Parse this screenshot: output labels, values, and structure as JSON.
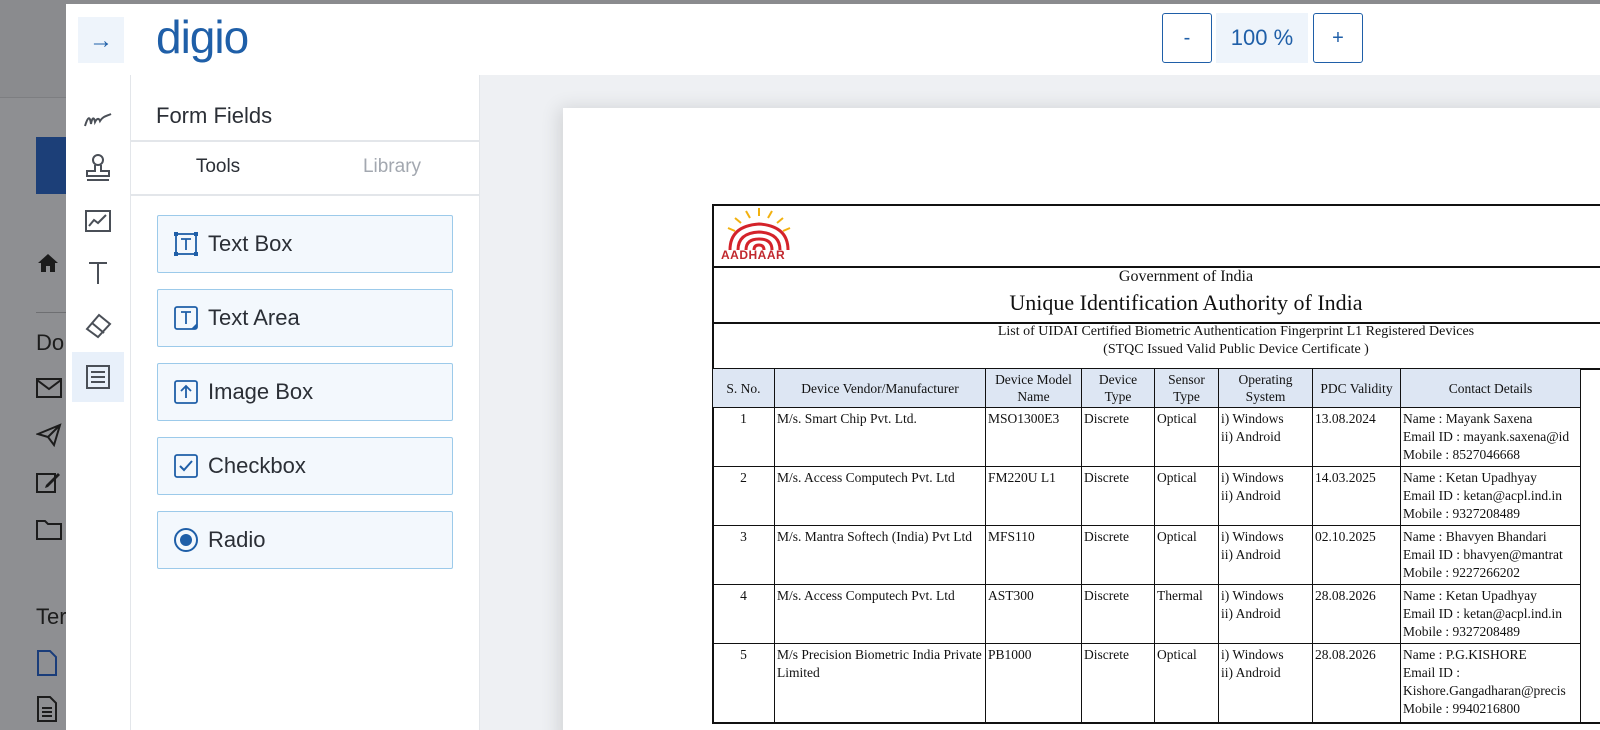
{
  "background": {
    "partial_labels": [
      "Do",
      "Ter"
    ]
  },
  "header": {
    "back_icon": "arrow-right-icon",
    "logo_text": "digio",
    "zoom": {
      "minus_label": "-",
      "level": "100 %",
      "plus_label": "+"
    }
  },
  "toolrail": {
    "items": [
      {
        "icon": "signature-icon"
      },
      {
        "icon": "stamp-icon"
      },
      {
        "icon": "chart-image-icon"
      },
      {
        "icon": "text-icon"
      },
      {
        "icon": "eraser-icon"
      },
      {
        "icon": "form-fields-icon",
        "active": true
      }
    ]
  },
  "panel": {
    "title": "Form Fields",
    "tabs": {
      "tools": "Tools",
      "library": "Library"
    },
    "fields": [
      {
        "label": "Text Box",
        "icon": "text-box-icon"
      },
      {
        "label": "Text Area",
        "icon": "text-area-icon"
      },
      {
        "label": "Image Box",
        "icon": "image-upload-icon"
      },
      {
        "label": "Checkbox",
        "icon": "checkbox-icon"
      },
      {
        "label": "Radio",
        "icon": "radio-icon"
      }
    ]
  },
  "document": {
    "logo_text": "AADHAAR",
    "government": "Government of India",
    "authority": "Unique Identification Authority of  India",
    "list_title": "List of UIDAI Certified Biometric Authentication Fingerprint L1 Registered Devices",
    "list_subtitle": "(STQC Issued  Valid Public Device Certificate )",
    "table": {
      "headers": [
        "S. No.",
        "Device Vendor/Manufacturer",
        "Device Model Name",
        "Device Type",
        "Sensor Type",
        "Operating System",
        "PDC Validity",
        "Contact Details"
      ],
      "rows": [
        {
          "sno": "1",
          "vendor": "M/s. Smart Chip Pvt. Ltd.",
          "model": "MSO1300E3",
          "type": "Discrete",
          "sensor": "Optical",
          "os1": "i) Windows",
          "os2": "ii) Android",
          "pdc": "13.08.2024",
          "c1": "Name : Mayank Saxena",
          "c2": "Email ID : mayank.saxena@id",
          "c3": "Mobile : 8527046668"
        },
        {
          "sno": "2",
          "vendor": "M/s. Access Computech Pvt. Ltd",
          "model": "FM220U L1",
          "type": "Discrete",
          "sensor": "Optical",
          "os1": "i) Windows",
          "os2": "ii) Android",
          "pdc": "14.03.2025",
          "c1": "Name : Ketan Upadhyay",
          "c2": "Email ID : ketan@acpl.ind.in",
          "c3": "Mobile : 9327208489"
        },
        {
          "sno": "3",
          "vendor": "M/s. Mantra Softech (India) Pvt Ltd",
          "model": "MFS110",
          "type": "Discrete",
          "sensor": "Optical",
          "os1": "i) Windows",
          "os2": "ii) Android",
          "pdc": "02.10.2025",
          "c1": "Name : Bhavyen Bhandari",
          "c2": "Email ID : bhavyen@mantrat",
          "c3": "Mobile : 9227266202"
        },
        {
          "sno": "4",
          "vendor": "M/s. Access Computech Pvt. Ltd",
          "model": "AST300",
          "type": "Discrete",
          "sensor": "Thermal",
          "os1": "i) Windows",
          "os2": "ii) Android",
          "pdc": "28.08.2026",
          "c1": "Name : Ketan Upadhyay",
          "c2": "Email ID : ketan@acpl.ind.in",
          "c3": "Mobile : 9327208489"
        },
        {
          "sno": "5",
          "vendor": "M/s Precision Biometric India Private Limited",
          "model": "PB1000",
          "type": "Discrete",
          "sensor": "Optical",
          "os1": "i) Windows",
          "os2": "ii) Android",
          "pdc": "28.08.2026",
          "c1": "Name : P.G.KISHORE",
          "c2": "Email ID :",
          "c3": "Kishore.Gangadharan@precis",
          "c4": "Mobile : 9940216800"
        }
      ]
    }
  },
  "colors": {
    "brand": "#1f5fa8",
    "field_border": "#9ccaea",
    "field_bg": "#f3f8fd",
    "table_header_bg": "#dde6f3"
  }
}
